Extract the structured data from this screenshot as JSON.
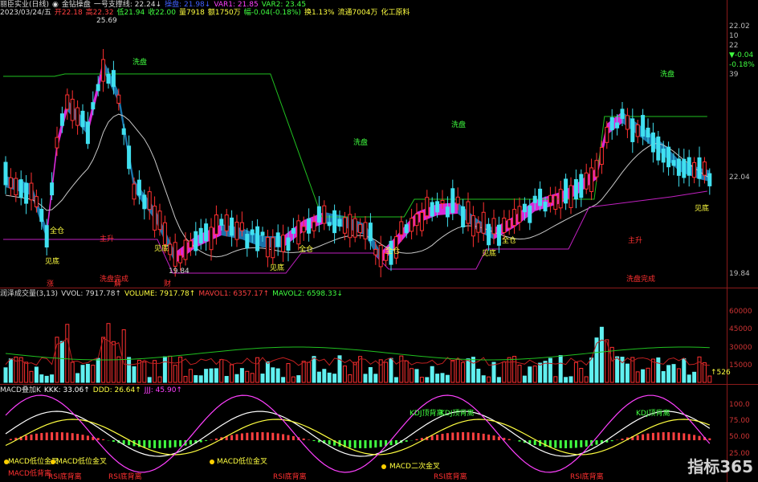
{
  "main_header": {
    "symbol": "丽臣实业(日线)",
    "indicator": "金钻操盘",
    "line_label": "一号支撑线: 22.24↓",
    "var0": "操盘: 21.98↓",
    "var1": "VAR1: 21.85",
    "var2": "VAR2: 23.45"
  },
  "quote_bar": {
    "date": "2023/03/24/五",
    "open": "开22.18",
    "high": "高22.32",
    "low": "低21.94",
    "close": "收22.00",
    "volume": "量7918",
    "amount": "额1750万",
    "change": "幅-0.04(-0.18%)",
    "turnover": "换1.13%",
    "float": "流通7004万",
    "industry": "化工原料"
  },
  "right_axis": {
    "top_price": "22.02",
    "top_vol": "10",
    "top_x": "22",
    "chg": "▼-0.04",
    "chgp": "-0.18%",
    "num": "39",
    "mid_price": "22.04",
    "low_price": "19.84",
    "vol_ticks": [
      "60000",
      "45000",
      "30000",
      "15000"
    ],
    "vol_last": "↑526",
    "kdj_ticks": [
      "100.0",
      "75.00",
      "50.00",
      "25.00"
    ]
  },
  "vol_header": {
    "name": "润泽成交量(3,13)",
    "vvol": "VVOL: 7917.78↑",
    "volume": "VOLUME: 7917.78↑",
    "mavol1": "MAVOL1: 6357.17↑",
    "mavol2": "MAVOL2: 6598.33↓"
  },
  "kdj_header": {
    "name": "MACD叠加K",
    "kkk": "KKK: 33.06↑",
    "ddd": "DDD: 26.64↑",
    "jjj": "JJJ: 45.90↑"
  },
  "price_annotations": {
    "high_mark": "25.69",
    "low_mark": "19.84",
    "wash": [
      "洗盘",
      "洗盘",
      "洗盘",
      "洗盘"
    ],
    "full": [
      "全仓",
      "全仓",
      "全仓",
      "全仓"
    ],
    "rise": [
      "主升",
      "主升"
    ],
    "bottom": [
      "见底",
      "见底",
      "见底",
      "见底",
      "见底"
    ],
    "trap": [
      "洗盘完成",
      "洗盘完成"
    ],
    "tags": [
      "涨",
      "解",
      "财"
    ]
  },
  "kdj_annotations": {
    "golden": [
      "MACD低位金叉",
      "MACD低位金叉",
      "MACD低位金叉",
      "MACD二次金叉"
    ],
    "divergence": [
      "KDJ顶背离",
      "KDJ顶背离",
      "KDJ顶背离"
    ],
    "rsi": [
      "RSI底背离",
      "RSI底背离",
      "RSI底背离",
      "RSI底背离",
      "RSI底背离"
    ],
    "macd_low": "MACD低背离"
  },
  "colors": {
    "up": "#ff3030",
    "down": "#40e0f0",
    "ribbon_up": "#ff30ff",
    "ribbon_down": "#1e88c8",
    "support": "#20c020",
    "ma": "#c8c8c8",
    "low_line": "#c020c0",
    "axis": "#8b1a1a"
  },
  "logo": "指标365"
}
